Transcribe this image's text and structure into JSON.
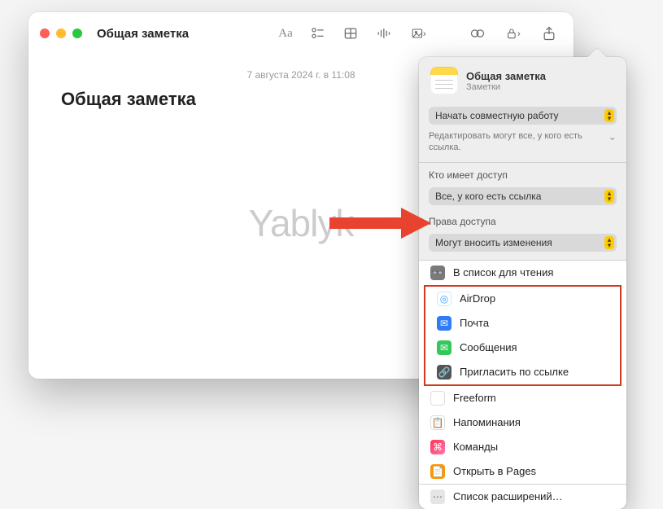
{
  "window": {
    "title": "Общая заметка"
  },
  "note": {
    "timestamp": "7 августа 2024 г. в 11:08",
    "title": "Общая заметка"
  },
  "watermark": "Yablyk",
  "share": {
    "title": "Общая заметка",
    "app": "Заметки",
    "collab_mode": "Начать совместную работу",
    "collab_desc": "Редактировать могут все, у кого есть ссылка.",
    "access_label": "Кто имеет доступ",
    "access_value": "Все, у кого есть ссылка",
    "perm_label": "Права доступа",
    "perm_value": "Могут вносить изменения",
    "items": {
      "reading_list": "В список для чтения",
      "airdrop": "AirDrop",
      "mail": "Почта",
      "messages": "Сообщения",
      "invite_link": "Пригласить по ссылке",
      "freeform": "Freeform",
      "reminders": "Напоминания",
      "shortcuts": "Команды",
      "pages": "Открыть в Pages",
      "more": "Список расширений…"
    }
  }
}
